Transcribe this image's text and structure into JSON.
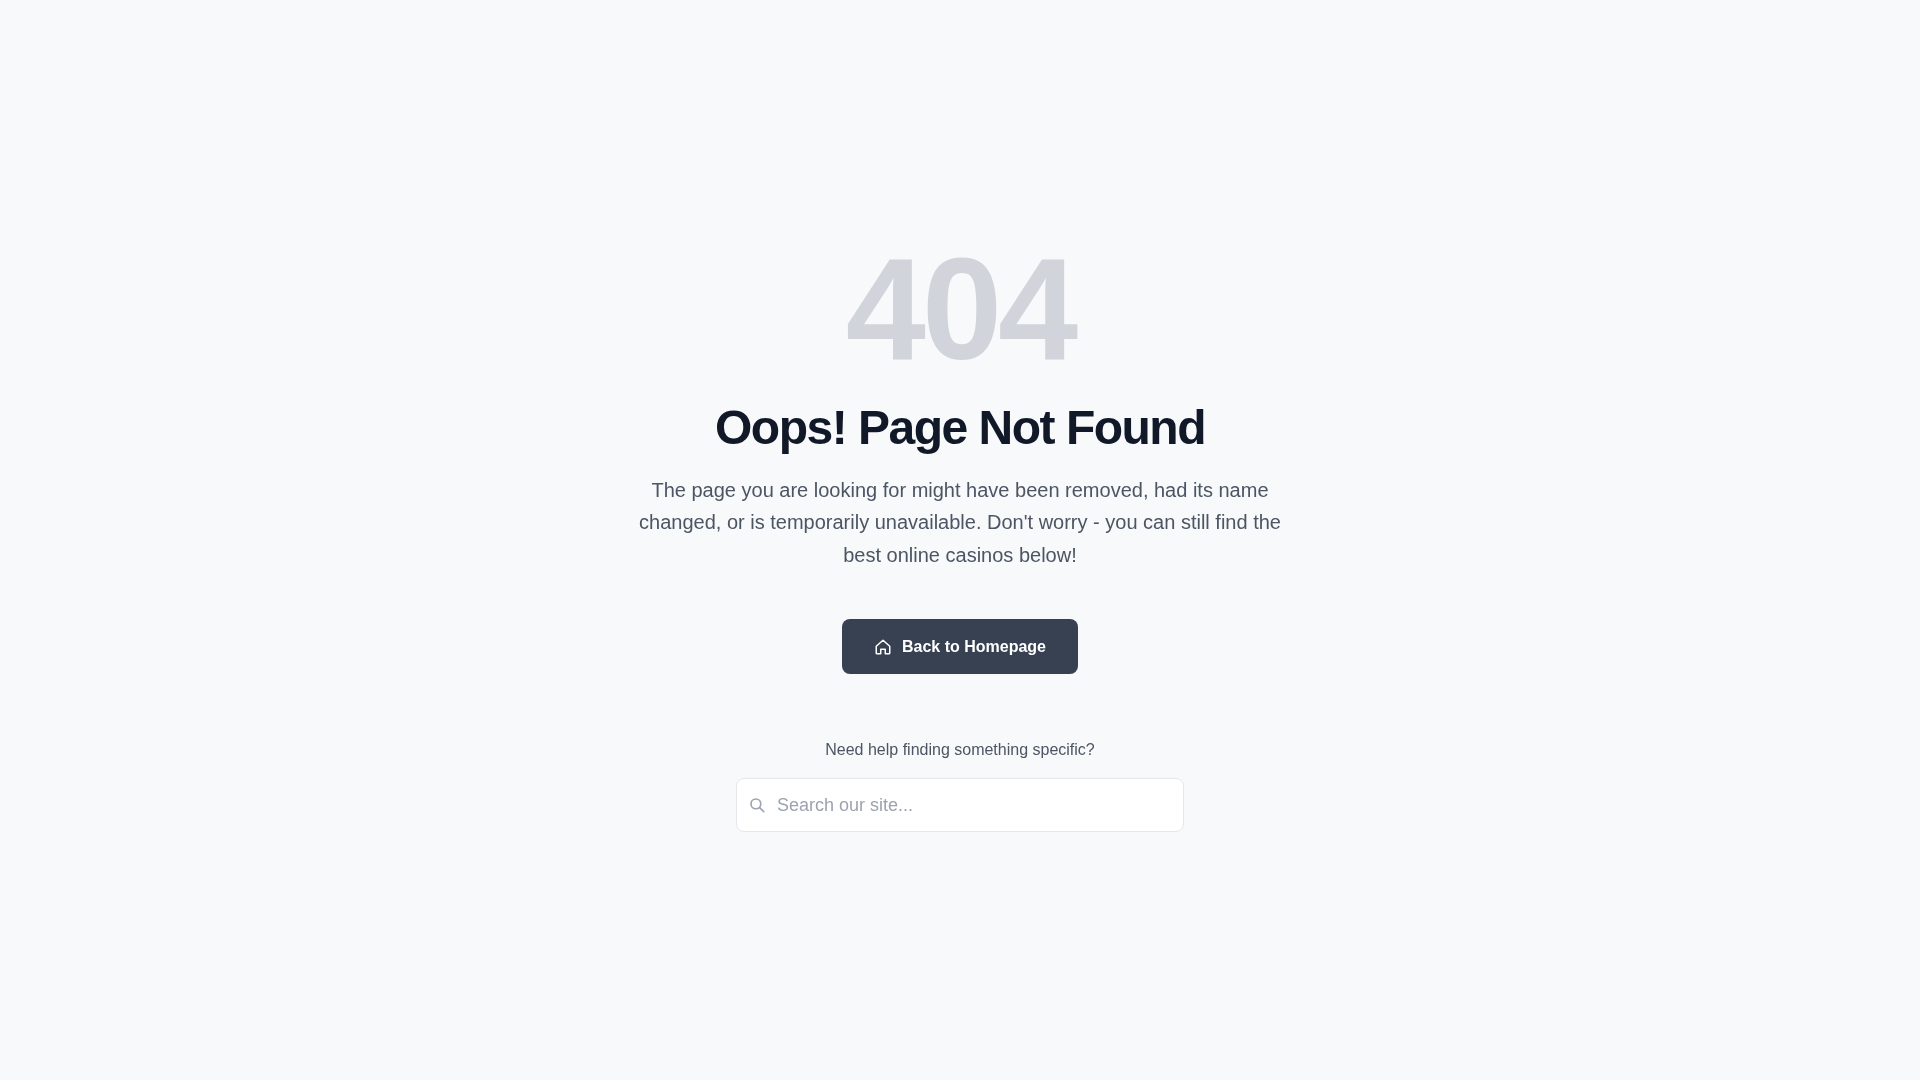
{
  "error_code": "404",
  "title": "Oops! Page Not Found",
  "message": "The page you are looking for might have been removed, had its name changed, or is temporarily unavailable. Don't worry - you can still find the best online casinos below!",
  "home_button": {
    "label": "Back to Homepage"
  },
  "help_text": "Need help finding something specific?",
  "search": {
    "placeholder": "Search our site..."
  }
}
